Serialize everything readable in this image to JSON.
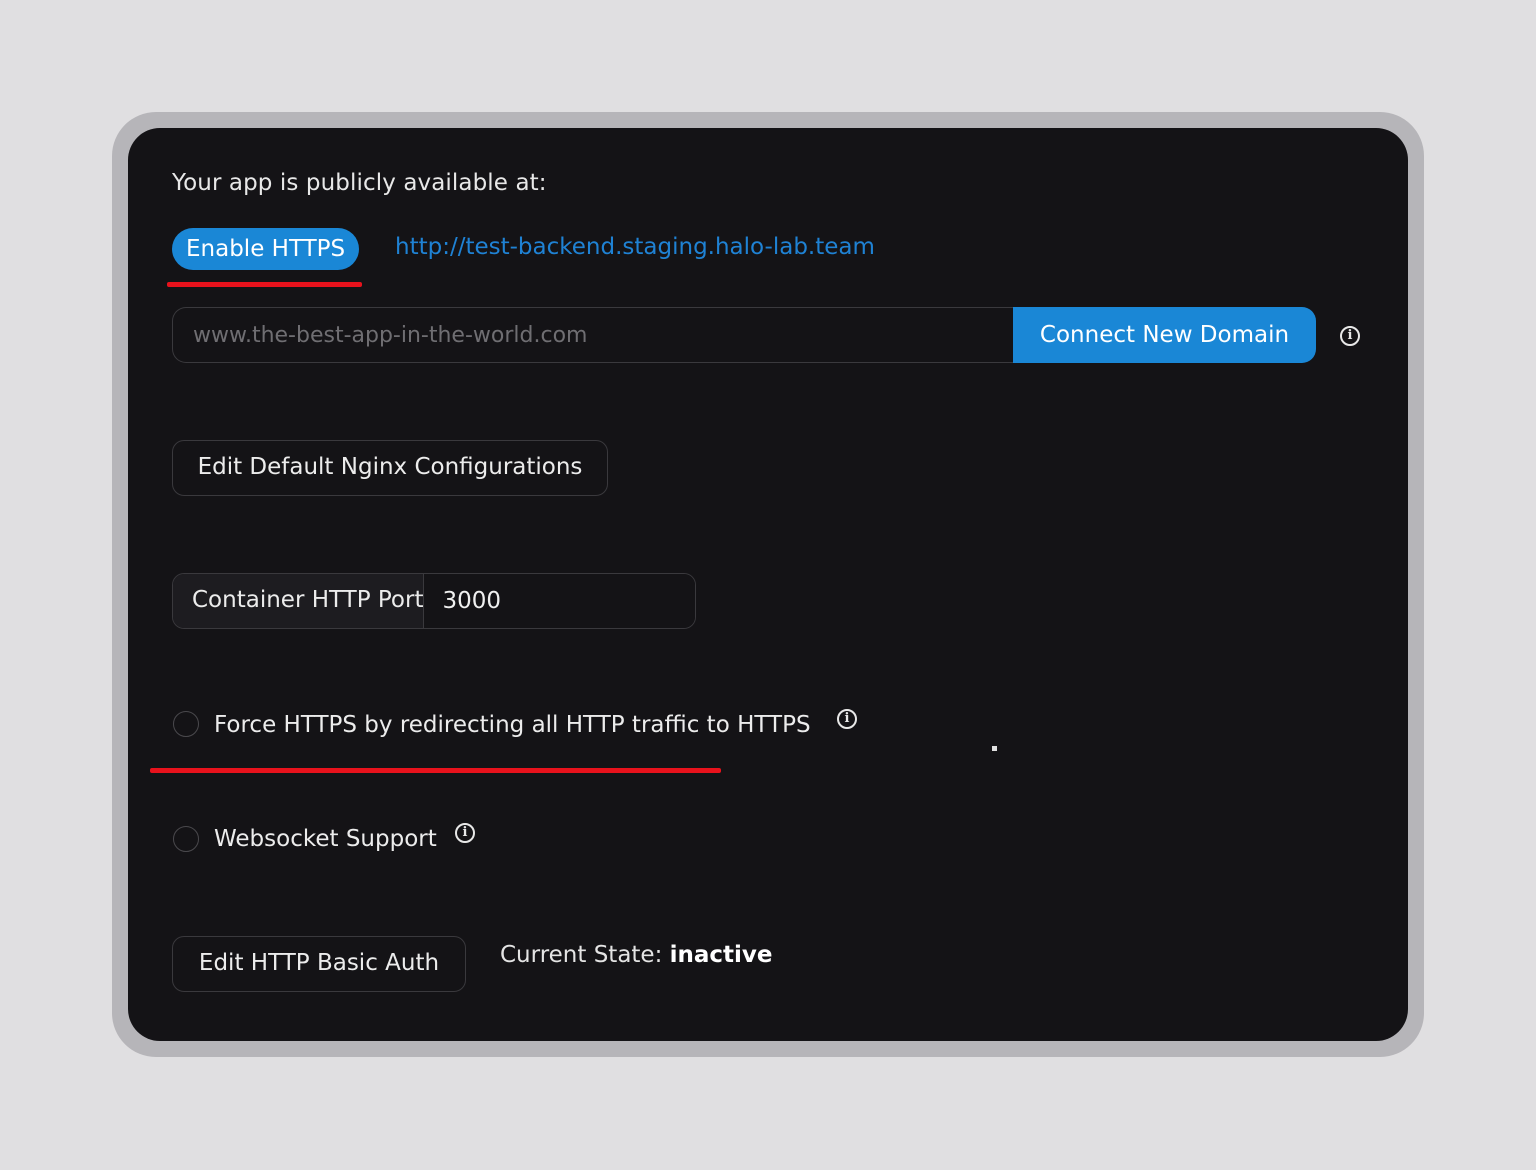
{
  "header": {
    "public_text": "Your app is publicly available at:"
  },
  "https": {
    "enable_label": "Enable HTTPS",
    "app_url": "http://test-backend.staging.halo-lab.team"
  },
  "domain": {
    "input_placeholder": "www.the-best-app-in-the-world.com",
    "input_value": "",
    "connect_label": "Connect New Domain"
  },
  "nginx": {
    "edit_label": "Edit Default Nginx Configurations"
  },
  "port": {
    "label": "Container HTTP Port",
    "value": "3000"
  },
  "options": {
    "force_https_label": "Force HTTPS by redirecting all HTTP traffic to HTTPS",
    "force_https_checked": false,
    "websocket_label": "Websocket Support",
    "websocket_checked": false
  },
  "auth": {
    "edit_label": "Edit HTTP Basic Auth",
    "state_prefix": "Current State: ",
    "state_value": "inactive"
  },
  "icons": {
    "info": "info-circle-icon",
    "info_glyph": "i"
  },
  "colors": {
    "accent": "#1a87d6",
    "highlight": "#e8121c",
    "panel_bg": "#141316",
    "page_bg": "#e0dfe1"
  }
}
